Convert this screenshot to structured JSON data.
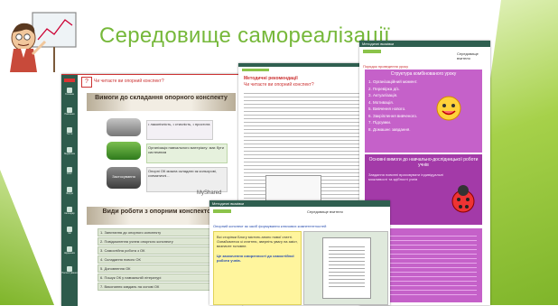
{
  "slide": {
    "title": "Середовище самореалізації"
  },
  "shot_main": {
    "question": "Чи читаєте ви опорний конспект?",
    "heading": "Вимоги до складання опорного конспекту",
    "items": [
      {
        "left": "",
        "right": "• лаконічність, • стислість, • простота"
      },
      {
        "left": "",
        "right": "Організація навчального матеріалу: має бути системним"
      },
      {
        "left": "Застосування",
        "right": "Опорні ОК можна складати як кольорові, схематичні..."
      }
    ],
    "watermark": "MyShared",
    "heading2": "Види роботи з опорним конспектом",
    "list": [
      "1. Запитання до опорного конспекту",
      "2. Повідомлення учнем опорного конспекту",
      "3. Самостійна робота з ОК",
      "4. Складання нового ОК",
      "5. Доповнення ОК",
      "6. Пошук ОК у навчальній літературі",
      "7. Виконання завдань на основі ОК"
    ],
    "sidebar_items": [
      "Головна",
      "Навчання",
      "Тести",
      "Медіатека",
      "Блог",
      "Форум",
      "Календар",
      "Чат",
      "Щоденник",
      "Налаштування"
    ]
  },
  "shot_doc": {
    "heading": "Методичні рекомендації",
    "sub": "Чи читаєте ви опорний конспект?"
  },
  "shot_purple": {
    "window_title": "Методичні вказівки",
    "header_right": "Середовище вчителя",
    "subheading": "Порядок проведення уроку",
    "heading": "Структура комбінованого уроку",
    "list": [
      "1. Організаційний момент.",
      "2. Перевірка д/з.",
      "3. Актуалізація.",
      "4. Мотивація.",
      "5. Вивчення нового.",
      "6. Закріплення вивченого.",
      "7. Підсумки.",
      "8. Домашнє завдання."
    ],
    "heading2": "Основні вимоги до навчально-дослідницької роботи учнів",
    "para": "Завдання повинні враховувати індивідуальні можливості та здібності учнів"
  },
  "shot_bottom": {
    "window_title": "Методичні вказівки",
    "header_right": "Середовище вчителя",
    "blue_text": "Опорний конспект як засіб формування ключових компетентностей",
    "left_para1": "Всі сторінки Блогу містять анонс нової статті. Ознайомтеся зі статтею, зверніть увагу на зміст, визначте головне.",
    "left_para2": "Це заохочення смиренності до самостійної роботи учнів."
  },
  "colors": {
    "accent_green": "#76b83a",
    "purple": "#c561c9",
    "dark_purple": "#7d2b86"
  }
}
